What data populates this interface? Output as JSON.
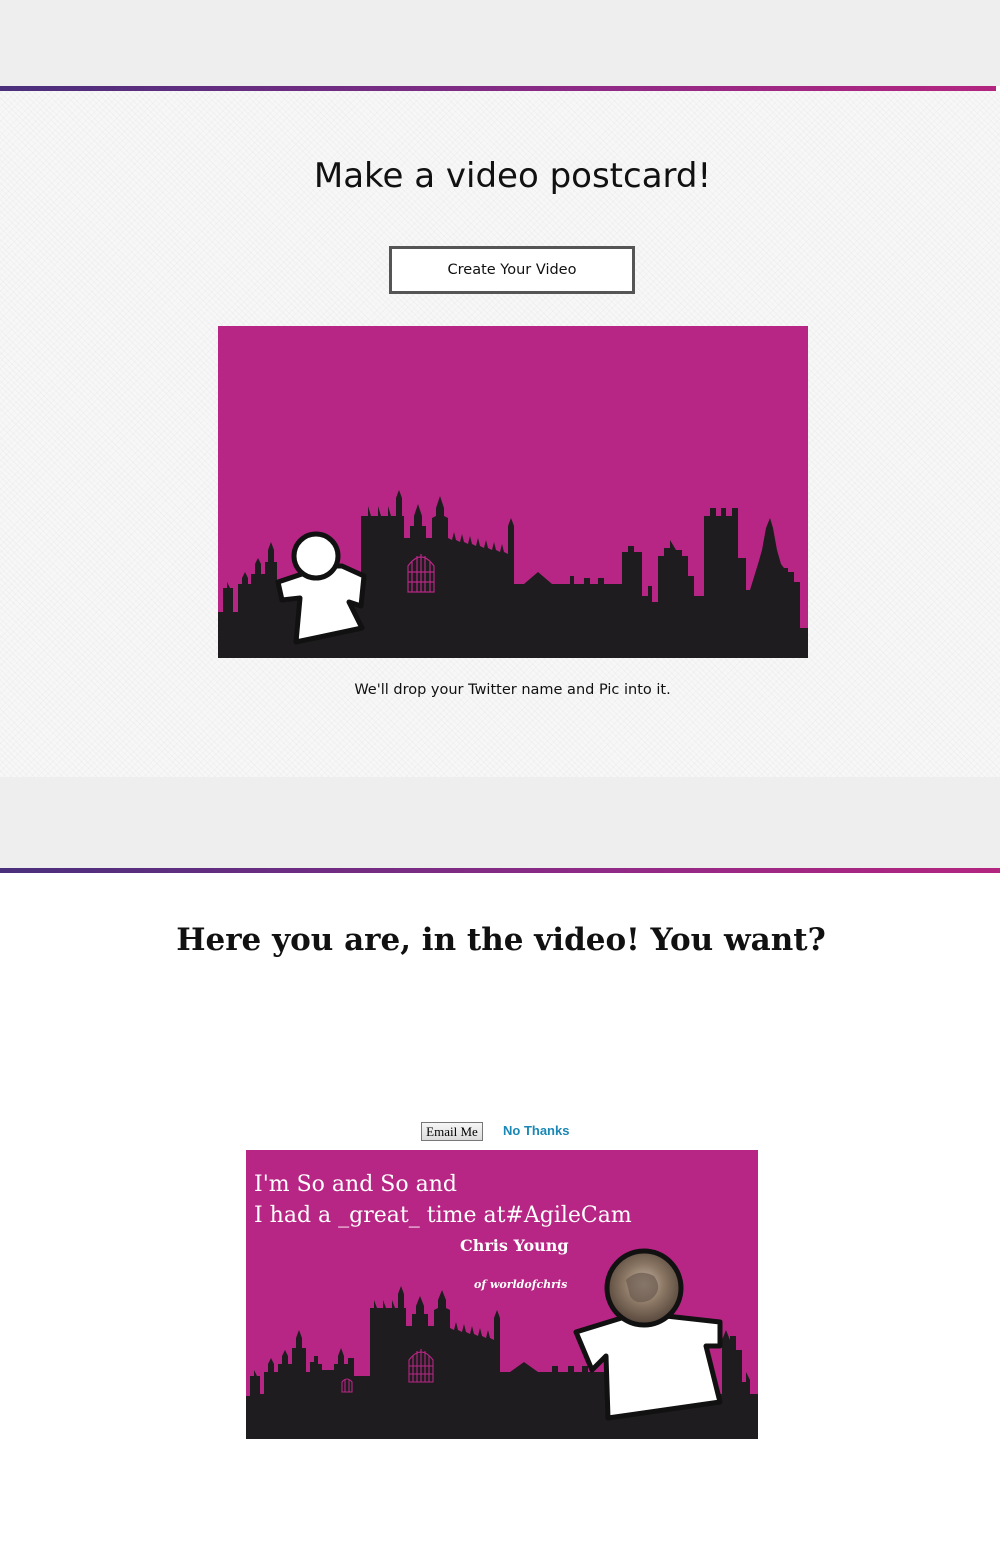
{
  "section1": {
    "title": "Make a video postcard!",
    "create_button_label": "Create Your Video",
    "caption": "We'll drop your Twitter name and Pic into it."
  },
  "section2": {
    "title": "Here you are, in the video! You want?",
    "email_button_label": "Email Me",
    "no_thanks_label": "No Thanks",
    "postcard": {
      "line1": "I'm So and So and",
      "line2": "I had a _great_ time at#AgileCam",
      "name": "Chris Young",
      "handle": "of worldofchris"
    }
  },
  "colors": {
    "brand_magenta": "#b82685",
    "skyline": "#1e1c1e",
    "link_blue": "#1a87b5",
    "gradient_start": "#4a2f7d",
    "gradient_end": "#b3257f"
  }
}
